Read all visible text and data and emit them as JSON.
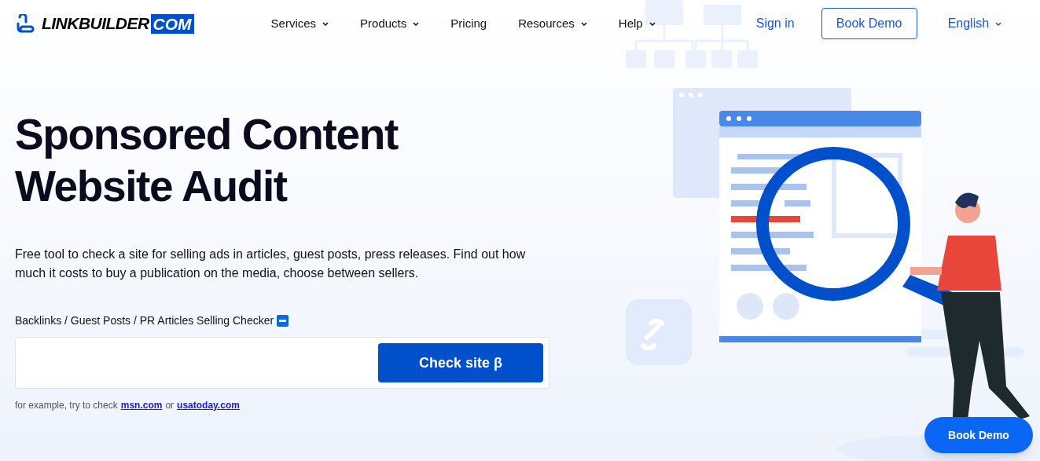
{
  "logo": {
    "name": "LINKBUILDER",
    "suffix": "COM"
  },
  "nav": [
    {
      "label": "Services",
      "dropdown": true
    },
    {
      "label": "Products",
      "dropdown": true
    },
    {
      "label": "Pricing",
      "dropdown": false
    },
    {
      "label": "Resources",
      "dropdown": true
    },
    {
      "label": "Help",
      "dropdown": true
    }
  ],
  "header_actions": {
    "sign_in": "Sign in",
    "book_demo": "Book Demo",
    "language": "English"
  },
  "hero": {
    "title_lines": [
      "Sponsored Content",
      "Website Audit"
    ],
    "description": "Free tool to check a site for selling ads in articles, guest posts, press releases. Find out how much it costs to buy a publication on the media, choose between sellers.",
    "checker_label": "Backlinks / Guest Posts / PR Articles Selling Checker",
    "check_button": "Check site β",
    "example_prefix": "for example, try to check",
    "examples": [
      "msn.com",
      "usatoday.com"
    ],
    "example_joiner": "or"
  },
  "floating_button": "Book Demo"
}
